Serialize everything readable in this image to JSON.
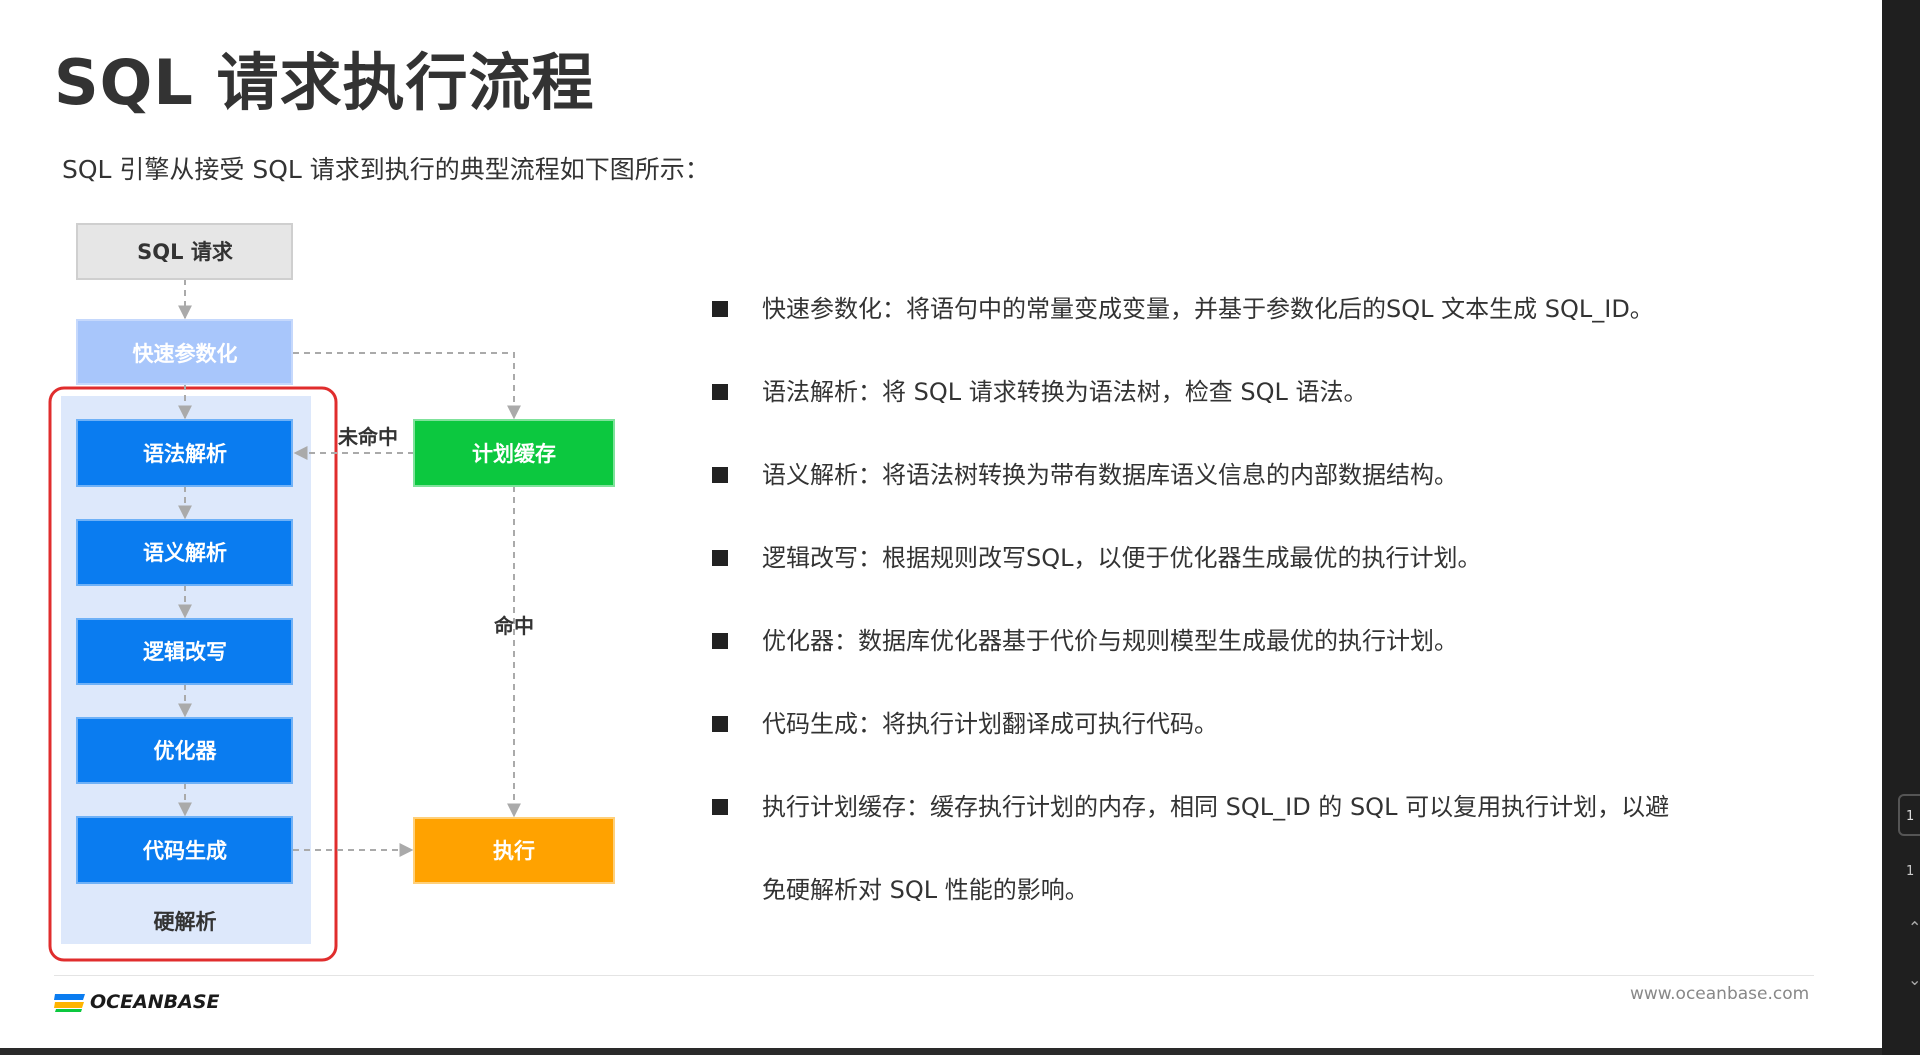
{
  "title": "SQL 请求执行流程",
  "subtitle": "SQL 引擎从接受 SQL 请求到执行的典型流程如下图所示：",
  "diagram": {
    "sql_request": "SQL 请求",
    "fast_param": "快速参数化",
    "plan_cache": "计划缓存",
    "syntax_parse": "语法解析",
    "semantic_parse": "语义解析",
    "logic_rewrite": "逻辑改写",
    "optimizer": "优化器",
    "code_gen": "代码生成",
    "execute": "执行",
    "hard_parse": "硬解析",
    "miss_label": "未命中",
    "hit_label": "命中"
  },
  "bullets": [
    "快速参数化：将语句中的常量变成变量，并基于参数化后的SQL 文本生成 SQL_ID。",
    "语法解析：将 SQL 请求转换为语法树，检查 SQL 语法。",
    "语义解析：将语法树转换为带有数据库语义信息的内部数据结构。",
    "逻辑改写：根据规则改写SQL，以便于优化器生成最优的执行计划。",
    "优化器：数据库优化器基于代价与规则模型生成最优的执行计划。",
    "代码生成：将执行计划翻译成可执行代码。",
    "执行计划缓存：缓存执行计划的内存，相同 SQL_ID 的 SQL 可以复用执行计划，以避",
    "免硬解析对 SQL 性能的影响。"
  ],
  "footer": {
    "logo_text": "OCEANBASE",
    "website": "www.oceanbase.com"
  },
  "side_panel": {
    "item1": "1",
    "item2": "1"
  },
  "colors": {
    "blue": "#0a7cf0",
    "light_blue": "#a8c6fb",
    "green": "#0cc83f",
    "orange": "#ffa200",
    "gray_box": "#e6e6e6",
    "hard_parse_bg": "#dde8fb",
    "red_frame": "#e02d2d"
  }
}
